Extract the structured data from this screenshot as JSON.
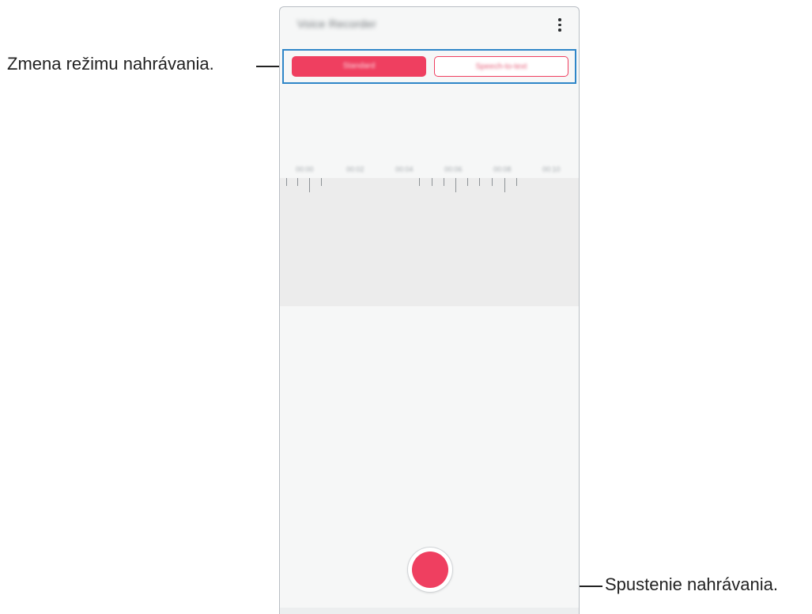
{
  "app": {
    "title": "Voice Recorder"
  },
  "modes": {
    "standard_label": "Standard",
    "speech_to_text_label": "Speech-to-text",
    "active": "Standard"
  },
  "timeline": {
    "labels": [
      "00:00",
      "00:02",
      "00:04",
      "00:06",
      "00:08",
      "00:10"
    ]
  },
  "callouts": {
    "mode_change": "Zmena režimu nahrávania.",
    "start_recording": "Spustenie nahrávania."
  },
  "colors": {
    "accent": "#ef3f60",
    "highlight_frame": "#2f86c8"
  },
  "icons": {
    "menu": "more-vertical-icon",
    "record": "record-icon"
  }
}
